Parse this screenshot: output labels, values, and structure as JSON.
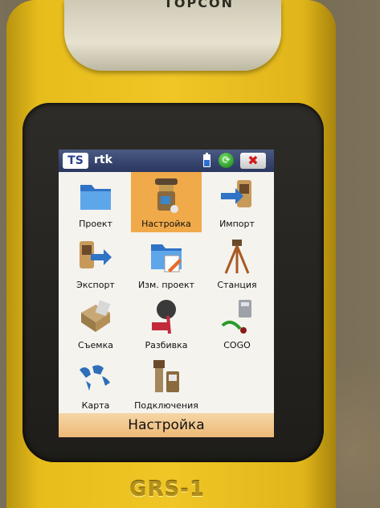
{
  "device": {
    "brand": "TOPCON",
    "model": "GRS-1"
  },
  "titlebar": {
    "logo": "TS",
    "title": "rtk",
    "close_label": "✖",
    "sync_label": "⟳"
  },
  "menu": [
    {
      "label": "Проект",
      "icon": "folder-icon"
    },
    {
      "label": "Настройка",
      "icon": "receiver-icon",
      "selected": true
    },
    {
      "label": "Импорт",
      "icon": "import-icon"
    },
    {
      "label": "Экспорт",
      "icon": "export-icon"
    },
    {
      "label": "Изм. проект",
      "icon": "edit-folder-icon"
    },
    {
      "label": "Станция",
      "icon": "tripod-icon"
    },
    {
      "label": "Съемка",
      "icon": "survey-icon"
    },
    {
      "label": "Разбивка",
      "icon": "stakeout-icon"
    },
    {
      "label": "COGO",
      "icon": "cogo-icon"
    },
    {
      "label": "Карта",
      "icon": "map-icon"
    },
    {
      "label": "Подключения",
      "icon": "connection-icon"
    }
  ],
  "bottombar": {
    "label": "Настройка"
  }
}
